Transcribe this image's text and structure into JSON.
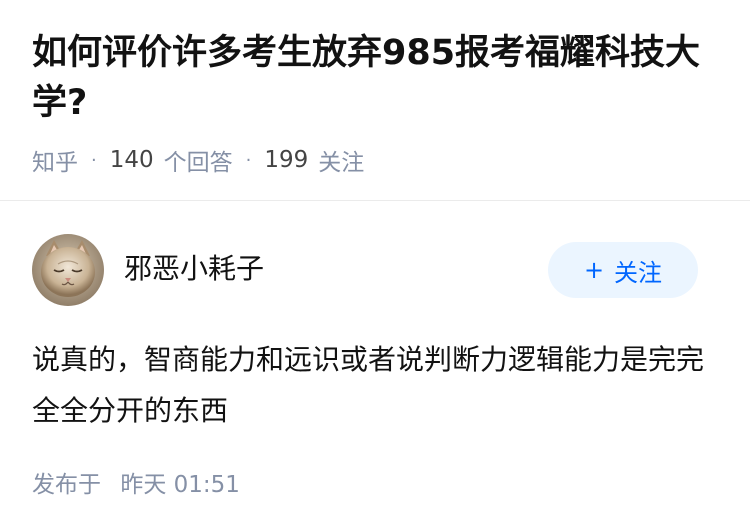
{
  "question": {
    "title": "如何评价许多考生放弃985报考福耀科技大学?",
    "source": "知乎",
    "separator": "·",
    "answer_count": "140",
    "answer_label": "个回答",
    "follower_count": "199",
    "follower_label": "关注"
  },
  "answer": {
    "author_name": "邪恶小耗子",
    "follow_button": {
      "icon": "plus-icon",
      "icon_glyph": "+",
      "label": "关注"
    },
    "content": "说真的，智商能力和远识或者说判断力逻辑能力是完完全全分开的东西",
    "posted_label": "发布于",
    "posted_time": "昨天 01:51"
  },
  "colors": {
    "title": "#121212",
    "meta": "#8590a6",
    "accent": "#0066ff",
    "follow_bg": "#ebf5ff",
    "divider": "#ebebeb"
  }
}
